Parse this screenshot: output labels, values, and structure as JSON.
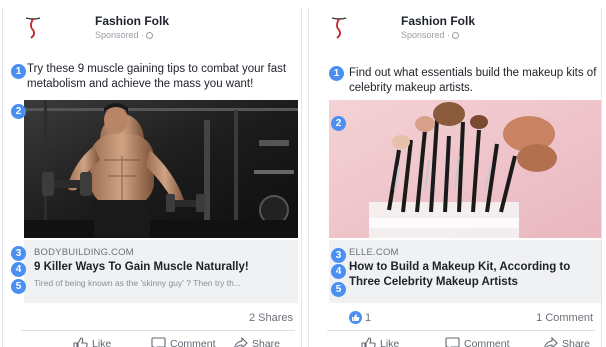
{
  "cards": [
    {
      "page_name": "Fashion Folk",
      "sponsored": "Sponsored ·",
      "text": "Try these 9 muscle gaining tips to combat your fast metabolism and achieve the mass you want!",
      "image_icon": "man-lifting-dumbbell-photo",
      "domain": "BODYBUILDING.COM",
      "headline": "9 Killer Ways To Gain Muscle Naturally!",
      "description": "Tired of being known as the 'skinny guy' ? Then try th...",
      "stats_text": "2 Shares",
      "reactions_count": ""
    },
    {
      "page_name": "Fashion Folk",
      "sponsored": "Sponsored ·",
      "text": "Find out what essentials build the makeup kits of celebrity makeup artists.",
      "image_icon": "makeup-brushes-photo",
      "domain": "ELLE.COM",
      "headline": "How to Build a Makeup Kit, According to Three Celebrity Makeup Artists",
      "description": "",
      "stats_text": "1 Comment",
      "reactions_count": "1"
    }
  ],
  "callouts": [
    "1",
    "2",
    "3",
    "4",
    "5"
  ],
  "actions": {
    "like": "Like",
    "comment": "Comment",
    "share": "Share"
  },
  "colors": {
    "callout_blue": "#4a8ff1",
    "link_box_bg": "#f0f1f3",
    "logo_red": "#c1272d"
  }
}
